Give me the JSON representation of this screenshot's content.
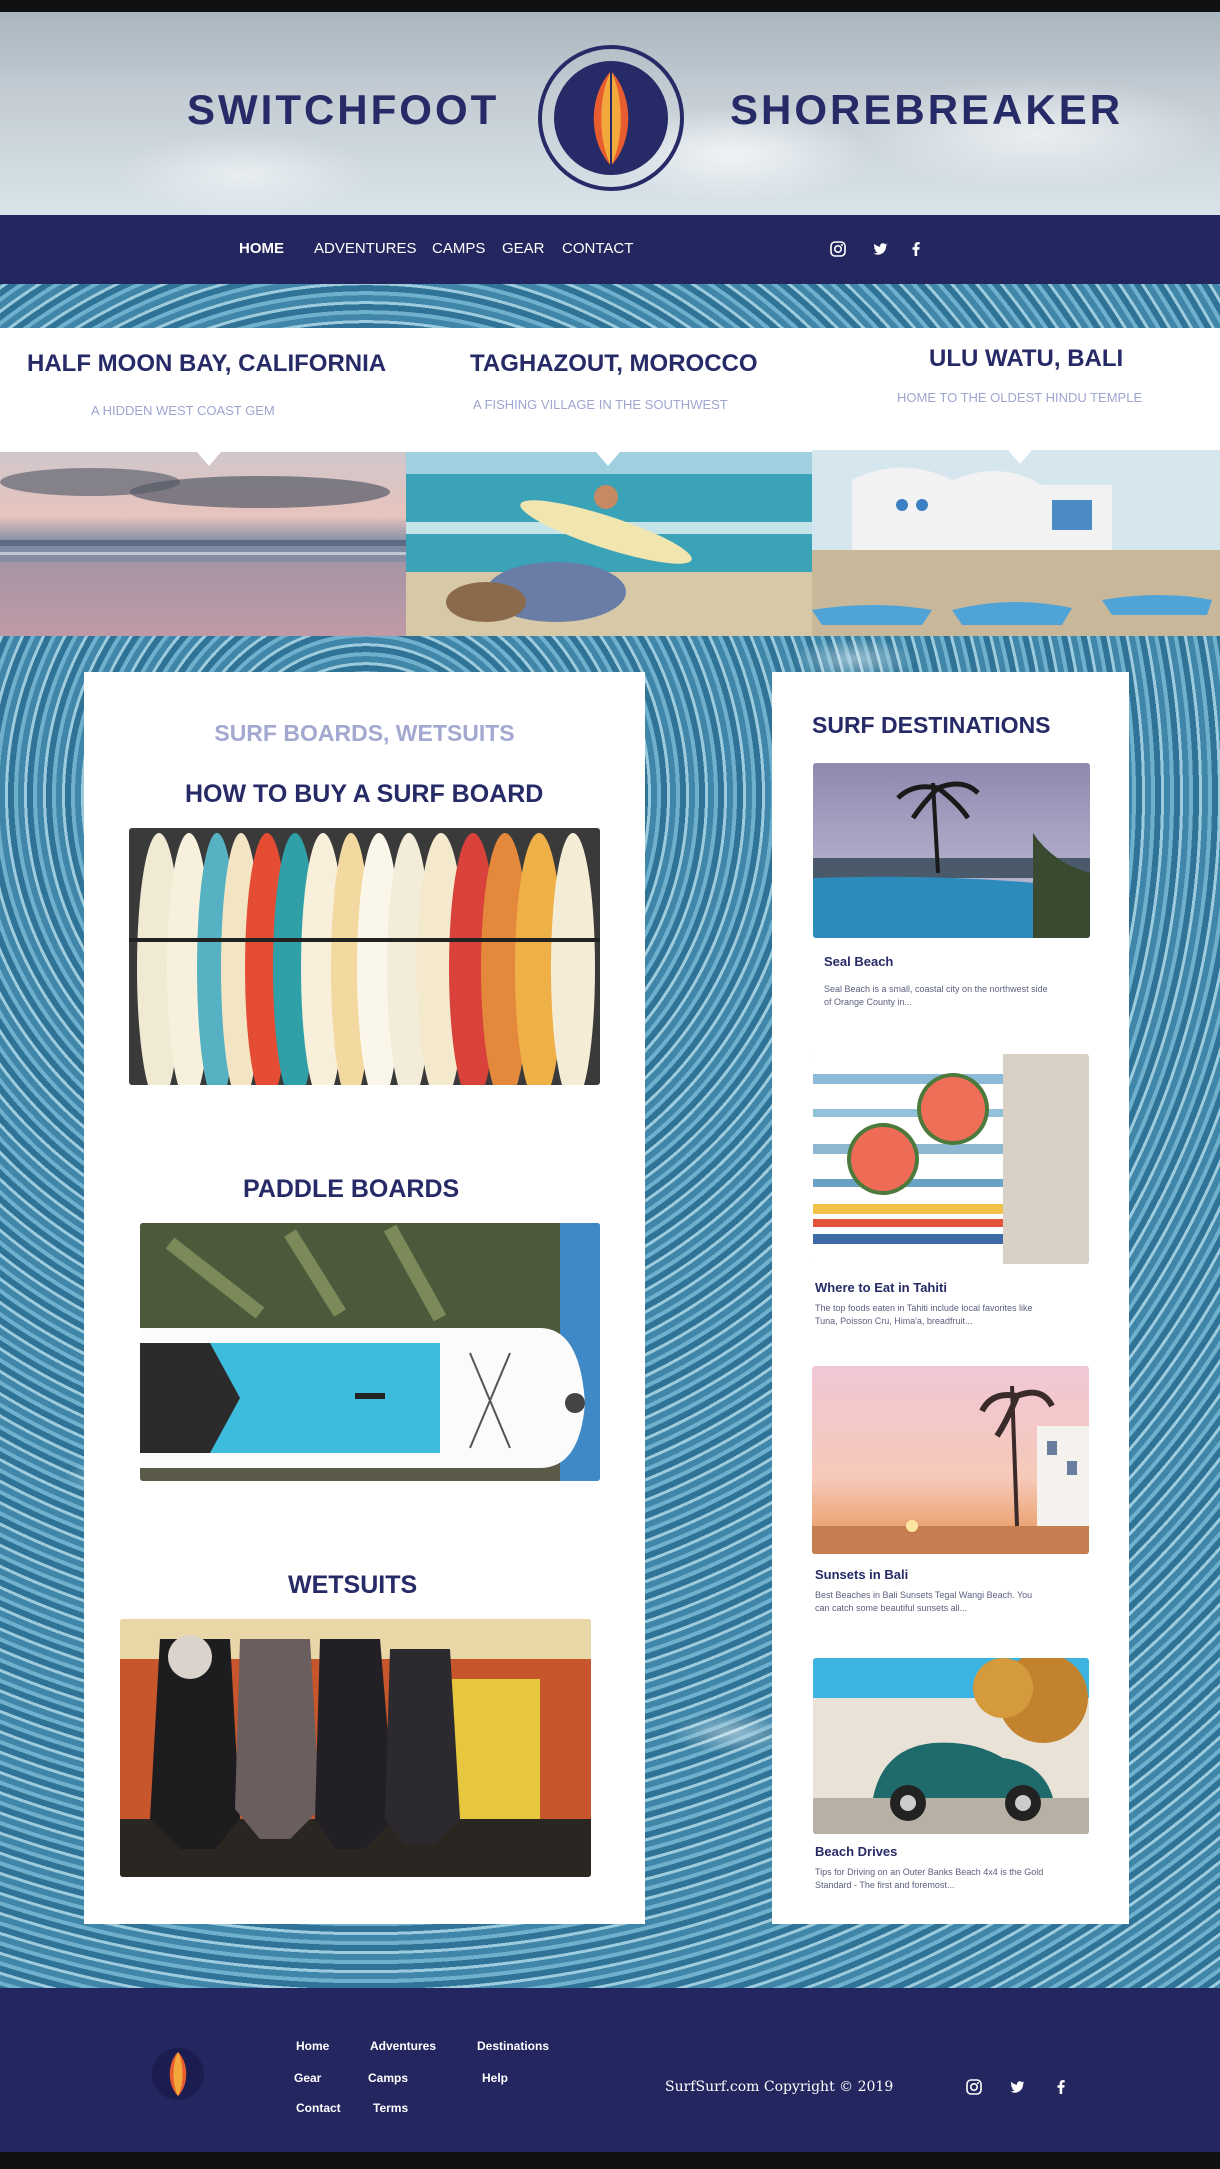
{
  "brand": {
    "left": "SWITCHFOOT",
    "right": "SHOREBREAKER"
  },
  "nav": {
    "items": [
      {
        "label": "HOME",
        "active": true
      },
      {
        "label": "ADVENTURES",
        "active": false
      },
      {
        "label": "CAMPS",
        "active": false
      },
      {
        "label": "GEAR",
        "active": false
      },
      {
        "label": "CONTACT",
        "active": false
      }
    ],
    "social": [
      "instagram-icon",
      "twitter-icon",
      "facebook-icon"
    ]
  },
  "locations": [
    {
      "title": "HALF MOON BAY, CALIFORNIA",
      "subtitle": "A HIDDEN WEST COAST GEM"
    },
    {
      "title": "TAGHAZOUT, MOROCCO",
      "subtitle": "A FISHING VILLAGE IN THE SOUTHWEST"
    },
    {
      "title": "ULU WATU, BALI",
      "subtitle": "HOME TO THE OLDEST HINDU TEMPLE"
    }
  ],
  "gear": {
    "kicker": "SURF BOARDS, WETSUITS",
    "sections": [
      {
        "title": "HOW TO BUY A SURF BOARD"
      },
      {
        "title": "PADDLE BOARDS"
      },
      {
        "title": "WETSUITS"
      }
    ]
  },
  "destinations": {
    "heading": "SURF DESTINATIONS",
    "items": [
      {
        "name": "Seal Beach",
        "desc": "Seal Beach is a small, coastal city on the northwest side of Orange County in..."
      },
      {
        "name": "Where to Eat in Tahiti",
        "desc": "The top foods eaten in Tahiti include local favorites like Tuna, Poisson Cru, Hima'a, breadfruit..."
      },
      {
        "name": "Sunsets in Bali",
        "desc": "Best Beaches in Bali Sunsets Tegal Wangi Beach. You can catch some beautiful sunsets all..."
      },
      {
        "name": "Beach Drives",
        "desc": "Tips for Driving on an Outer Banks Beach 4x4 is the Gold Standard - The first and foremost..."
      }
    ]
  },
  "footer": {
    "links": [
      "Home",
      "Adventures",
      "Destinations",
      "Gear",
      "Camps",
      "Help",
      "Contact",
      "Terms"
    ],
    "copyright": "SurfSurf.com Copyright © 2019"
  },
  "colors": {
    "navy": "#24265f",
    "brand_text": "#262a66",
    "muted_lavender": "#9ea6d0",
    "board_orange": "#e85d2f",
    "board_yellow": "#f2a83b"
  }
}
